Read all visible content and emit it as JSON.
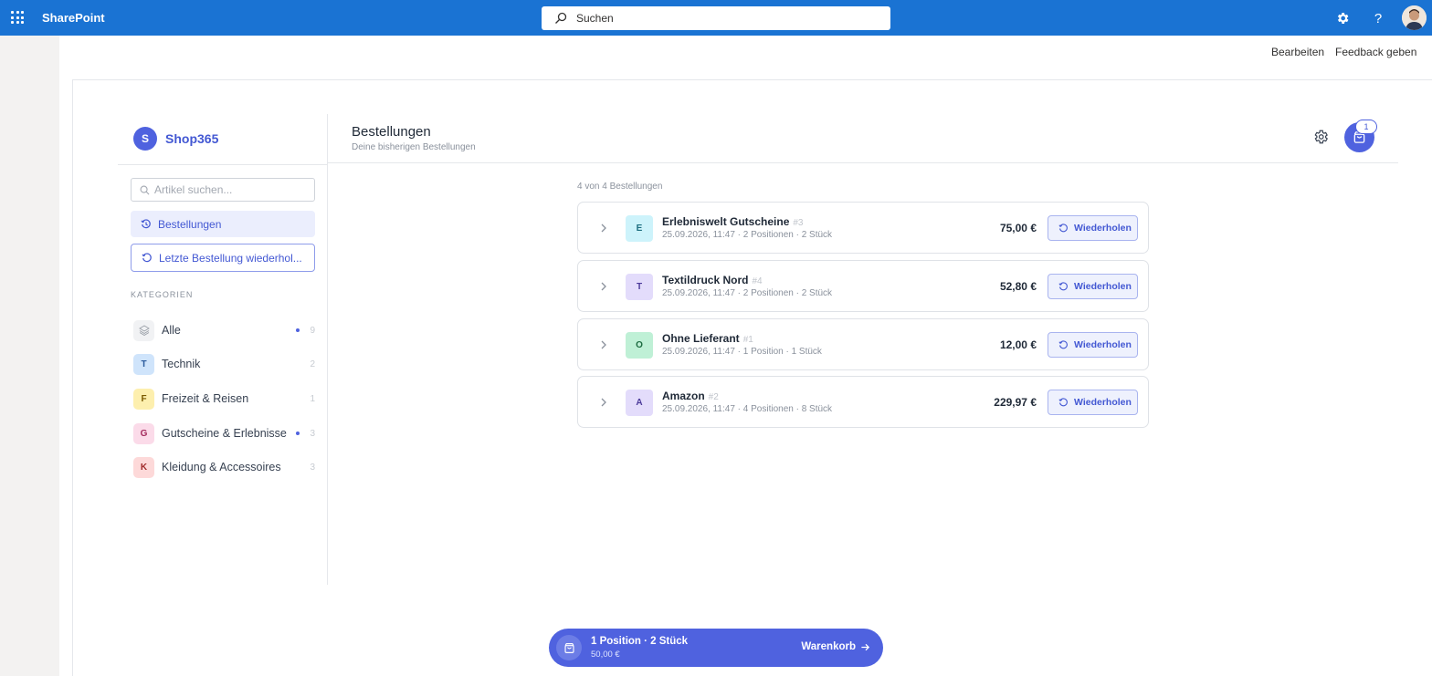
{
  "suite": {
    "app_name": "SharePoint",
    "search_placeholder": "Suchen"
  },
  "commands": {
    "edit": "Bearbeiten",
    "feedback": "Feedback geben"
  },
  "sidebar": {
    "shop_initial": "S",
    "shop_name": "Shop365",
    "search_placeholder": "Artikel suchen...",
    "nav_orders": "Bestellungen",
    "nav_repeat_last": "Letzte Bestellung wiederhol...",
    "categories_title": "KATEGORIEN",
    "categories": [
      {
        "badge": "",
        "label": "Alle",
        "count": "9",
        "dot": true,
        "badge_bg": "#f1f2f4",
        "badge_fg": "#9aa0a8"
      },
      {
        "badge": "T",
        "label": "Technik",
        "count": "2",
        "dot": false,
        "badge_bg": "#cfe4fb",
        "badge_fg": "#2a5a9c"
      },
      {
        "badge": "F",
        "label": "Freizeit & Reisen",
        "count": "1",
        "dot": false,
        "badge_bg": "#fdefae",
        "badge_fg": "#7a5a00"
      },
      {
        "badge": "G",
        "label": "Gutscheine & Erlebnisse",
        "count": "3",
        "dot": true,
        "badge_bg": "#fbdbe9",
        "badge_fg": "#a3295c"
      },
      {
        "badge": "K",
        "label": "Kleidung & Accessoires",
        "count": "3",
        "dot": false,
        "badge_bg": "#fdd9d9",
        "badge_fg": "#a12b2b"
      }
    ]
  },
  "main": {
    "title": "Bestellungen",
    "subtitle": "Deine bisherigen Bestellungen",
    "cart_count": "1",
    "orders_count_text": "4 von 4 Bestellungen",
    "repeat_label": "Wiederholen",
    "orders": [
      {
        "initial": "E",
        "name": "Erlebniswelt Gutscheine",
        "number": "#3",
        "meta": "25.09.2026, 11:47 · 2 Positionen · 2 Stück",
        "price": "75,00 €",
        "badge_bg": "#cdf3fb",
        "badge_fg": "#1d6e80"
      },
      {
        "initial": "T",
        "name": "Textildruck Nord",
        "number": "#4",
        "meta": "25.09.2026, 11:47 · 2 Positionen · 2 Stück",
        "price": "52,80 €",
        "badge_bg": "#e3dcfb",
        "badge_fg": "#4b3a9a"
      },
      {
        "initial": "O",
        "name": "Ohne Lieferant",
        "number": "#1",
        "meta": "25.09.2026, 11:47 · 1 Position · 1 Stück",
        "price": "12,00 €",
        "badge_bg": "#bff0d6",
        "badge_fg": "#1c6b40"
      },
      {
        "initial": "A",
        "name": "Amazon",
        "number": "#2",
        "meta": "25.09.2026, 11:47 · 4 Positionen · 8 Stück",
        "price": "229,97 €",
        "badge_bg": "#e3dcfb",
        "badge_fg": "#4b3a9a"
      }
    ]
  },
  "cartbar": {
    "summary": "1 Position · 2 Stück",
    "total": "50,00 €",
    "action": "Warenkorb"
  },
  "colors": {
    "suite_bar": "#1a73d3",
    "accent": "#4f62df"
  }
}
